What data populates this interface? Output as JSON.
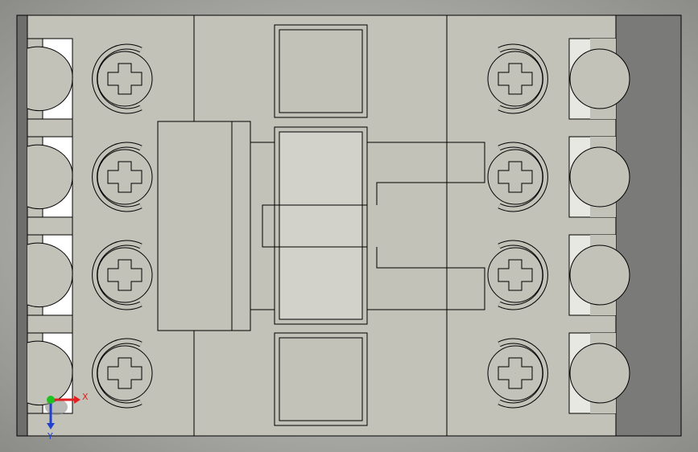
{
  "viewport": {
    "background_color": "#c8c8c4",
    "vignette_color": "#8c8c88",
    "model_colors": {
      "body": "#c2c2b9",
      "body_dark": "#7a7a78",
      "slot_white": "#ffffff",
      "slot_light": "#e8e8e2",
      "recess": "#d2d2cb",
      "edge": "#000000"
    }
  },
  "triad": {
    "x_label": "X",
    "y_label": "Y",
    "x_color": "#e02020",
    "y_color": "#2040d0",
    "z_color": "#20c020"
  }
}
